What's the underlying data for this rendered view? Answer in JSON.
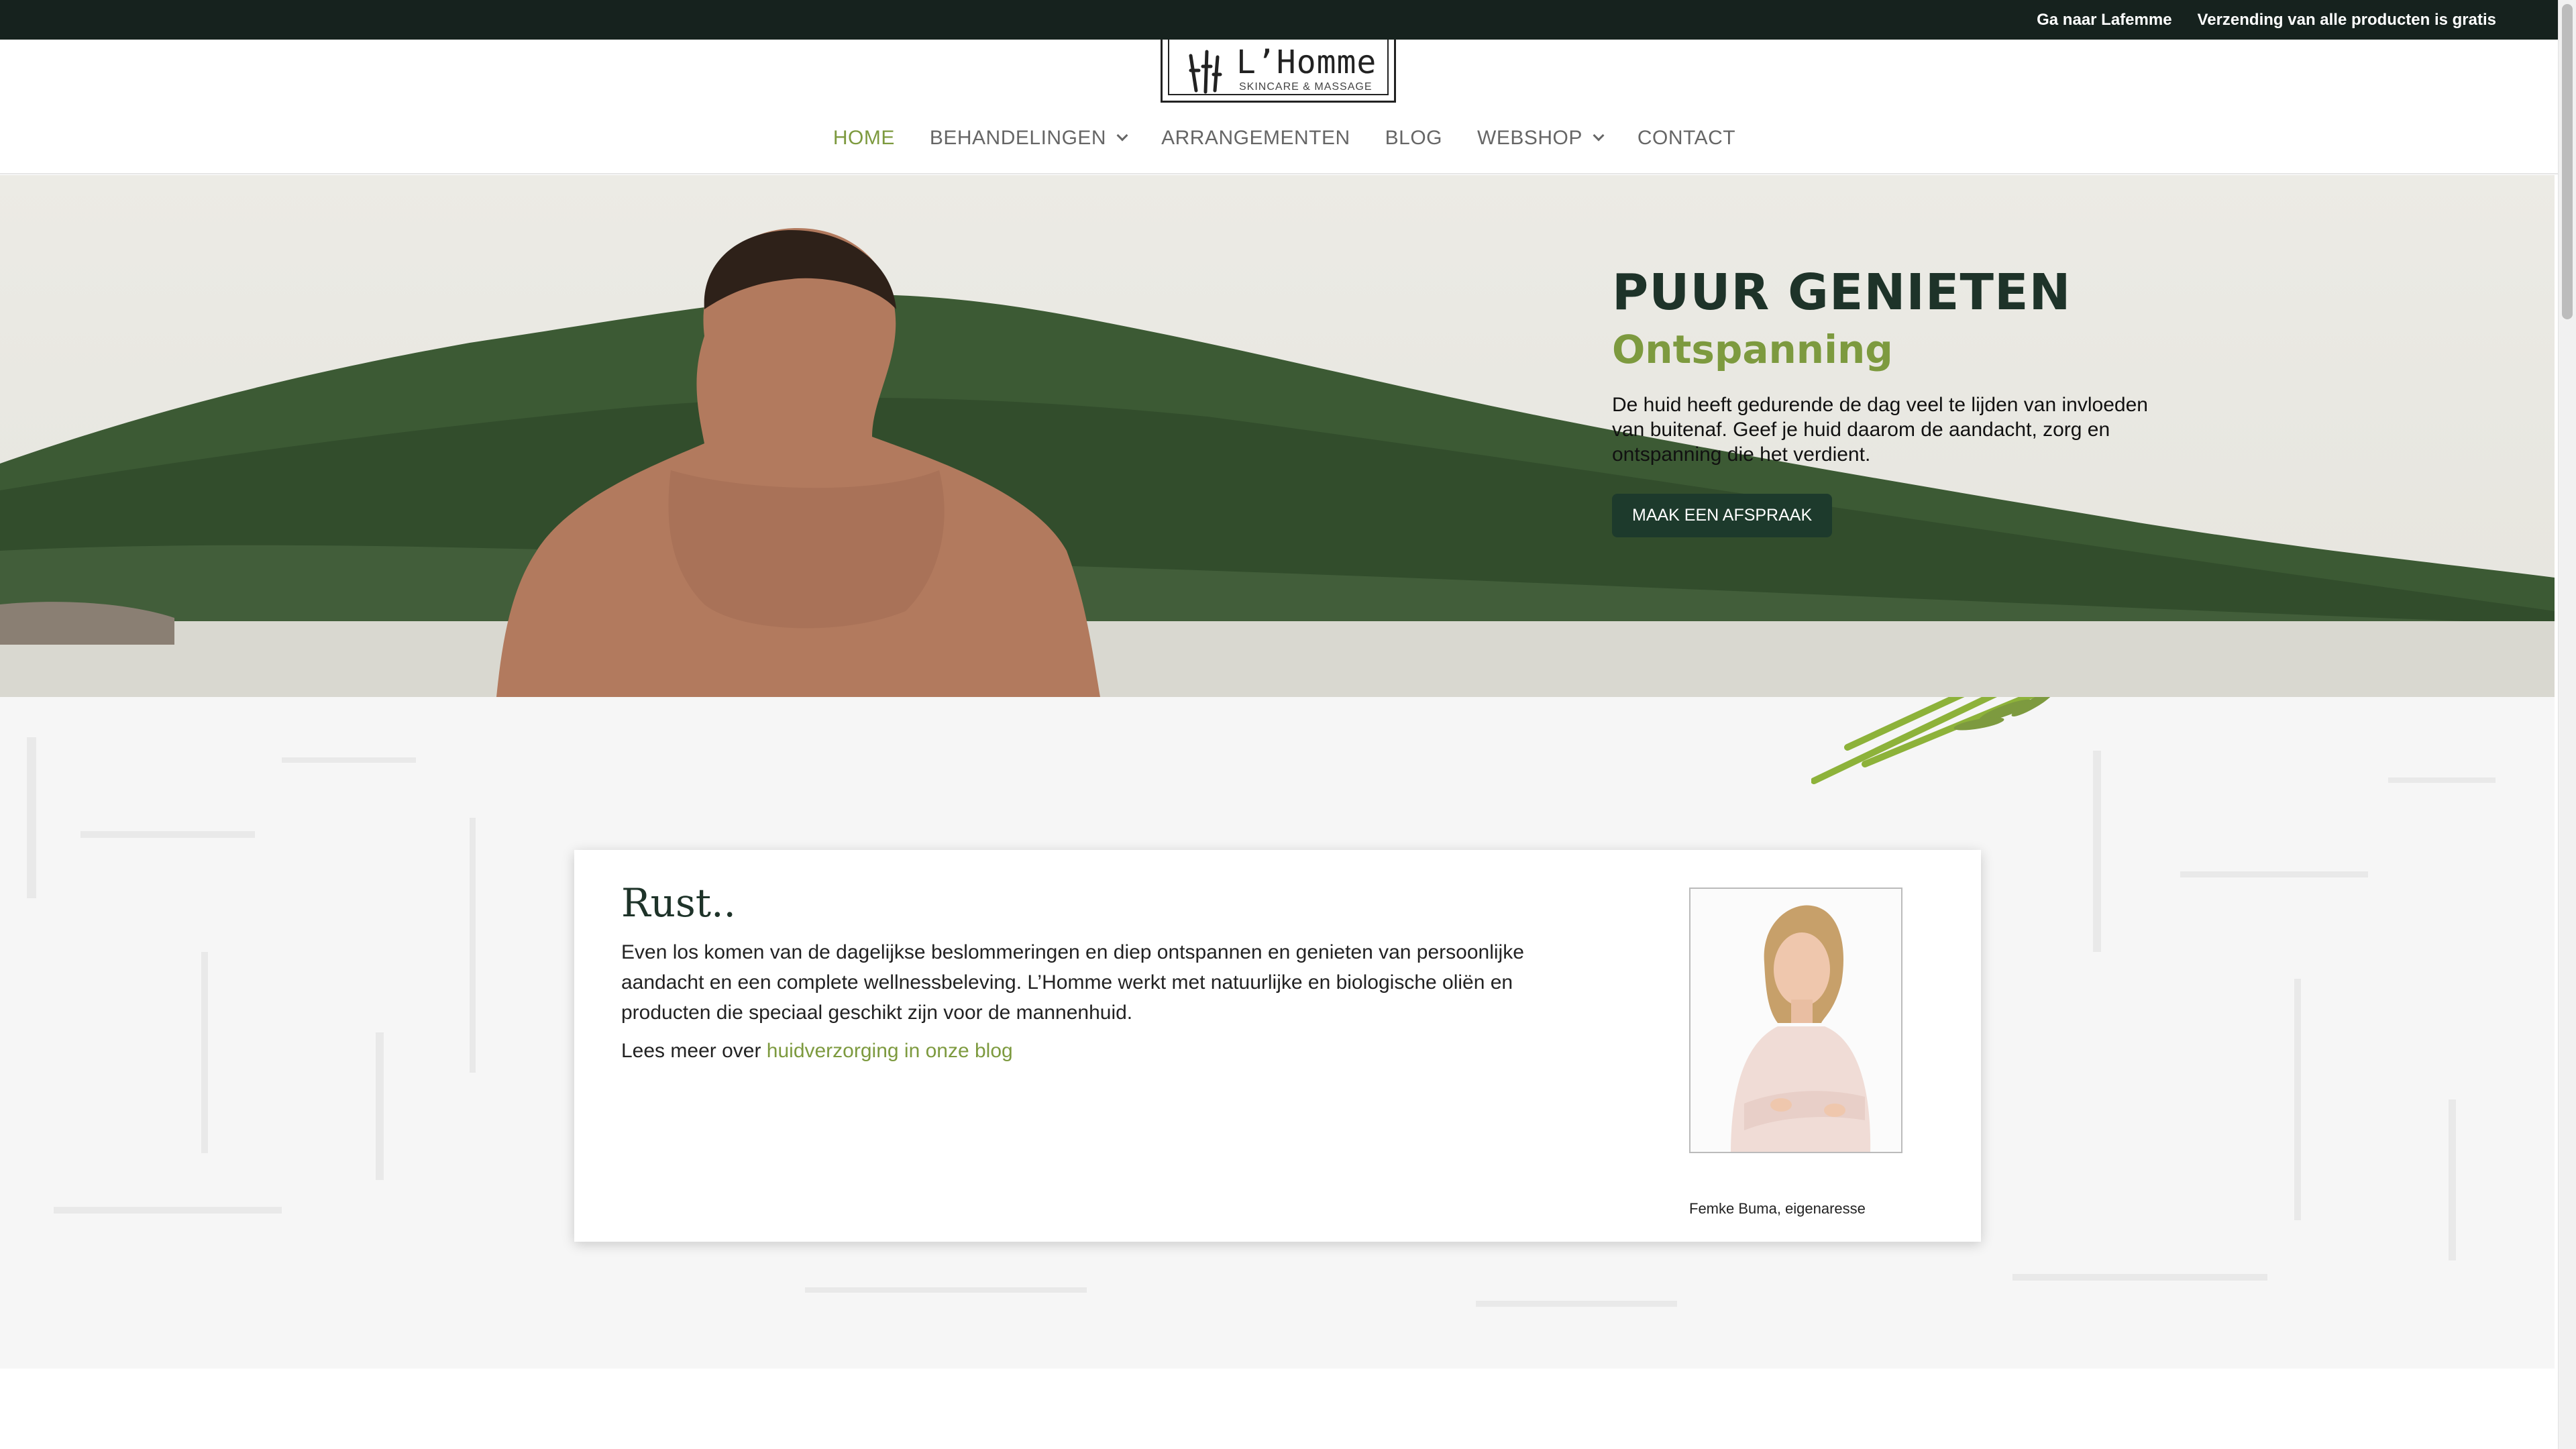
{
  "topbar": {
    "link1": "Ga naar Lafemme",
    "link2": "Verzending van alle producten is gratis"
  },
  "logo": {
    "name": "L’Homme",
    "subtitle": "SKINCARE & MASSAGE"
  },
  "nav": {
    "items": [
      {
        "label": "HOME",
        "active": true
      },
      {
        "label": "BEHANDELINGEN",
        "dropdown": true
      },
      {
        "label": "ARRANGEMENTEN"
      },
      {
        "label": "BLOG"
      },
      {
        "label": "WEBSHOP",
        "dropdown": true
      },
      {
        "label": "CONTACT"
      }
    ]
  },
  "hero": {
    "title": "PUUR GENIETEN",
    "subtitle": "Ontspanning",
    "text": "De huid heeft gedurende de dag veel te lijden van invloeden van buitenaf. Geef je huid daarom de aandacht, zorg en ontspanning die het verdient.",
    "button": "MAAK EEN AFSPRAAK"
  },
  "intro": {
    "title": "Rust..",
    "body": "Even los komen van de dagelijkse beslommeringen en diep ontspannen en genieten van persoonlijke aandacht en een complete wellnessbeleving. L’Homme werkt met natuurlijke en biologische oliën en producten die speciaal geschikt zijn voor de mannenhuid.",
    "more_prefix": "Lees meer over ",
    "more_link": "huidverzorging in onze blog",
    "caption": "Femke Buma, eigenaresse"
  },
  "colors": {
    "accent_green": "#7d9a3f",
    "dark_green": "#1d3a2c",
    "topbar": "#16221e"
  }
}
